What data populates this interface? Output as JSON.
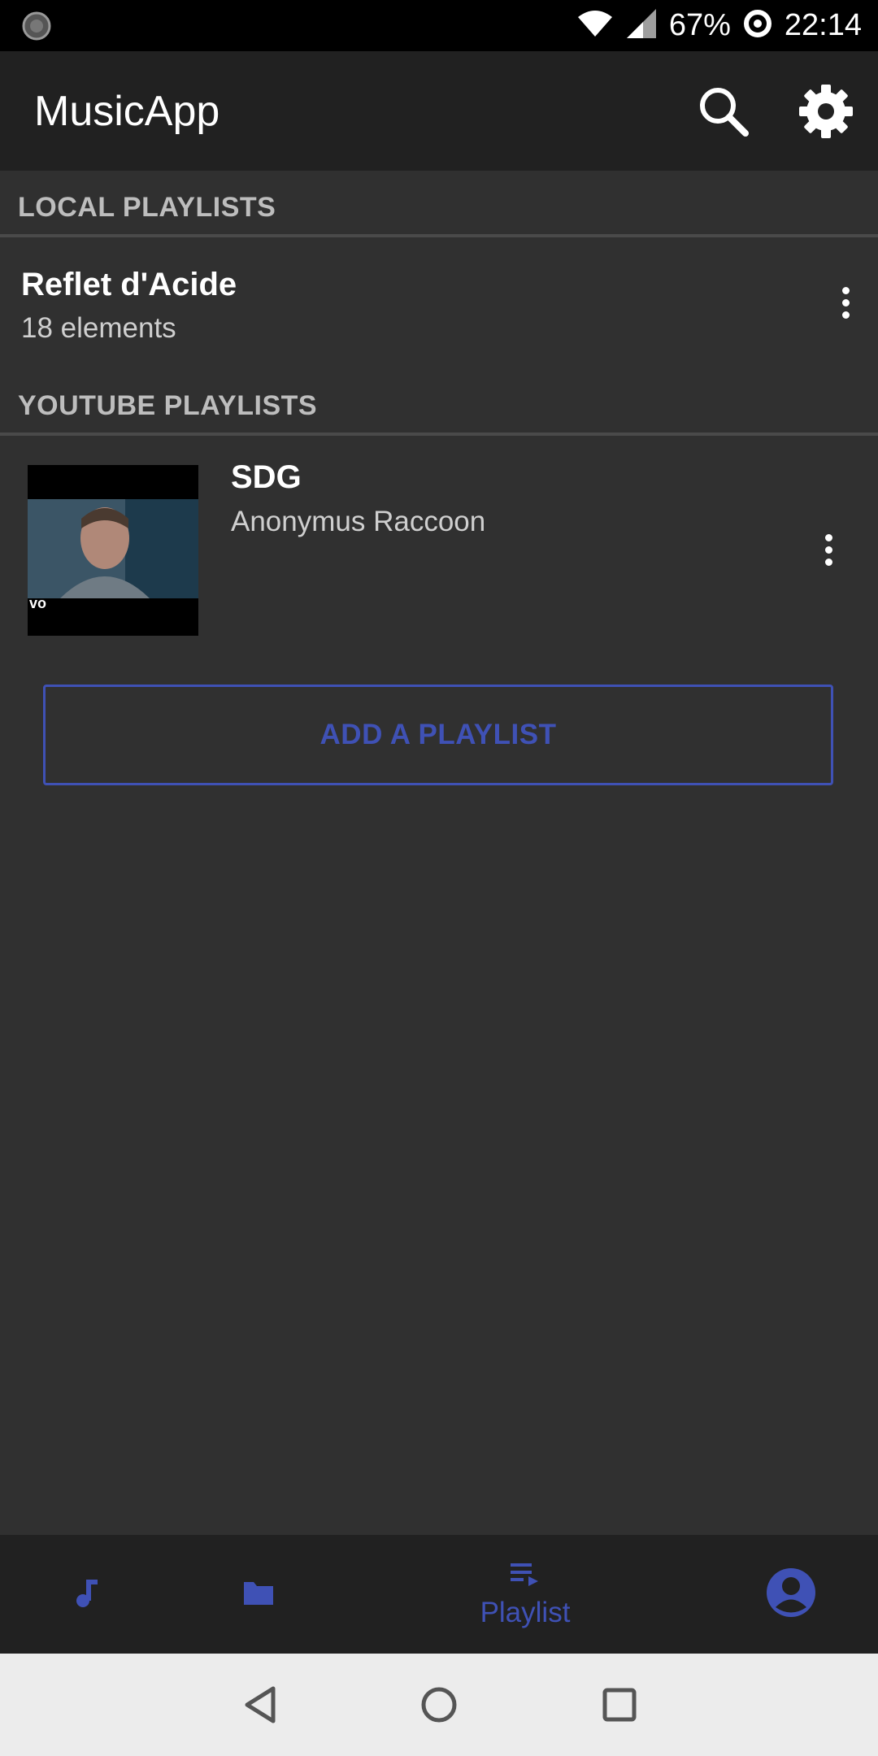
{
  "status_bar": {
    "battery": "67%",
    "time": "22:14",
    "icons": [
      "loading-indicator-icon",
      "wifi-icon",
      "cellular-signal-icon",
      "data-saver-icon"
    ]
  },
  "app_bar": {
    "title": "MusicApp",
    "actions": [
      "search-icon",
      "gear-icon"
    ]
  },
  "local_section": {
    "header": "LOCAL PLAYLISTS",
    "items": [
      {
        "title": "Reflet d'Acide",
        "subtitle": "18 elements"
      }
    ]
  },
  "youtube_section": {
    "header": "YOUTUBE PLAYLISTS",
    "items": [
      {
        "title": "SDG",
        "subtitle": "Anonymus Raccoon",
        "thumbnail_watermark": "vo"
      }
    ]
  },
  "add_button": {
    "label": "ADD A PLAYLIST"
  },
  "bottom_nav": {
    "items": [
      {
        "icon": "music-note-icon",
        "label": ""
      },
      {
        "icon": "folder-icon",
        "label": ""
      },
      {
        "icon": "playlist-icon",
        "label": "Playlist",
        "selected": true
      },
      {
        "icon": "account-icon",
        "label": ""
      }
    ]
  },
  "system_nav": {
    "icons": [
      "back-icon",
      "home-icon",
      "recents-icon"
    ]
  },
  "colors": {
    "accent": "#3f51b5",
    "background": "#303030",
    "app_bar": "#212121",
    "status_bar": "#000000",
    "section_header_text": "#bdbdbd"
  }
}
